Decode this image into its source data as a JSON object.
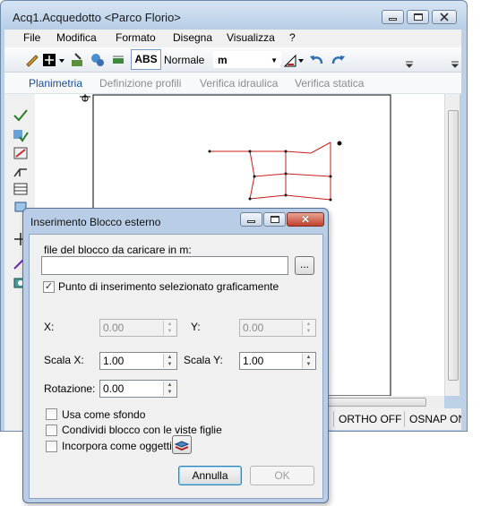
{
  "window": {
    "title": "Acq1.Acquedotto <Parco Florio>"
  },
  "menu": [
    "File",
    "Modifica",
    "Formato",
    "Disegna",
    "Visualizza",
    "?"
  ],
  "toolbar": {
    "abs_label": "ABS",
    "style_label": "Normale",
    "unit_value": "m"
  },
  "tabs": [
    "Planimetria",
    "Definizione profili",
    "Verifica idraulica",
    "Verifica statica"
  ],
  "status": {
    "ortho": "ORTHO OFF",
    "osnap": "OSNAP ON"
  },
  "dialog": {
    "title": "Inserimento Blocco esterno",
    "file_label": "file del blocco da caricare in m:",
    "file_value": "",
    "browse_label": "...",
    "insert_point_label": "Punto di inserimento selezionato graficamente",
    "insert_point_checked": true,
    "x_label": "X:",
    "x_value": "0.00",
    "y_label": "Y:",
    "y_value": "0.00",
    "scalex_label": "Scala X:",
    "scalex_value": "1.00",
    "scaley_label": "Scala Y:",
    "scaley_value": "1.00",
    "rotation_label": "Rotazione:",
    "rotation_value": "0.00",
    "use_background_label": "Usa come sfondo",
    "share_label": "Condividi blocco con le viste figlie",
    "embed_label": "Incorpora come oggetti",
    "cancel_label": "Annulla",
    "ok_label": "OK"
  }
}
